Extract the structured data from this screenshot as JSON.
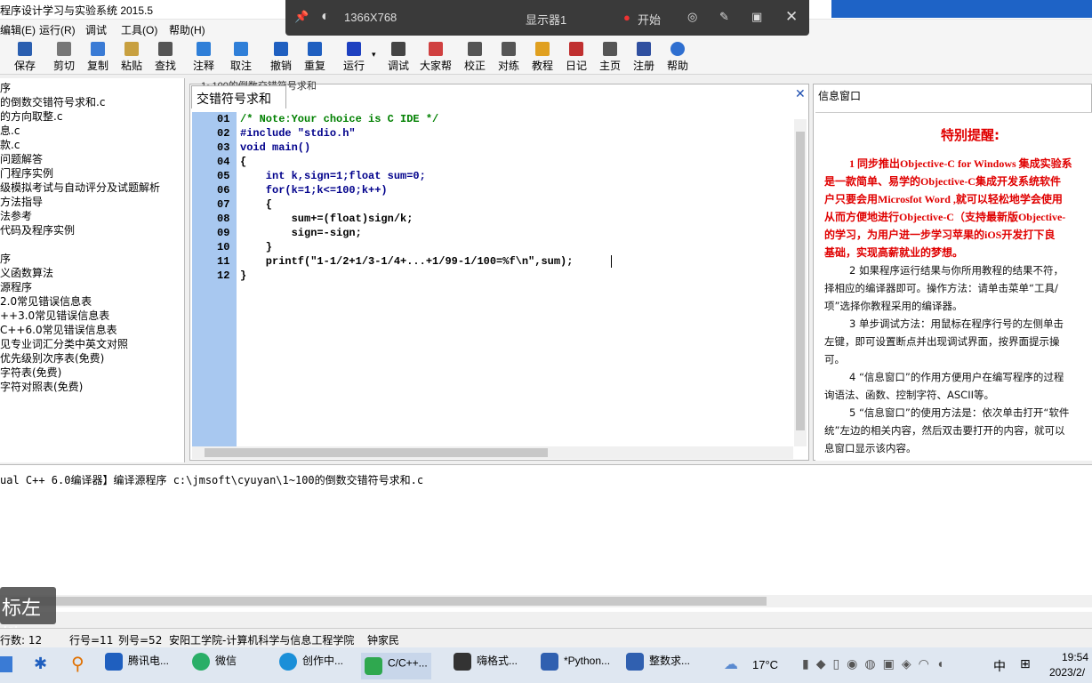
{
  "window": {
    "title": "程序设计学习与实验系统 2015.5"
  },
  "menu": [
    {
      "label": "编辑(E)"
    },
    {
      "label": "运行(R)"
    },
    {
      "label": "调试"
    },
    {
      "label": "工具(O)"
    },
    {
      "label": "帮助(H)"
    }
  ],
  "toolbar": [
    {
      "label": "保存",
      "icon": "save-icon",
      "color": "#2b5fb0"
    },
    {
      "label": "剪切",
      "icon": "cut-icon",
      "color": "#666666"
    },
    {
      "label": "复制",
      "icon": "copy-icon",
      "color": "#3a7bd5"
    },
    {
      "label": "粘贴",
      "icon": "paste-icon",
      "color": "#c8a040"
    },
    {
      "label": "查找",
      "icon": "find-icon",
      "color": "#555555"
    },
    {
      "label": "注释",
      "icon": "comment-icon",
      "color": "#2f7fd8"
    },
    {
      "label": "取注",
      "icon": "uncomment-icon",
      "color": "#2f7fd8"
    },
    {
      "label": "撤销",
      "icon": "undo-icon",
      "color": "#1f5fc0"
    },
    {
      "label": "重复",
      "icon": "redo-icon",
      "color": "#1f5fc0"
    },
    {
      "label": "运行",
      "icon": "run-icon",
      "color": "#1e40c0"
    },
    {
      "label": "调试",
      "icon": "debug-icon",
      "color": "#444444"
    },
    {
      "label": "大家帮",
      "icon": "help-people-icon",
      "color": "#d04040"
    },
    {
      "label": "校正",
      "icon": "check-icon",
      "color": "#444444"
    },
    {
      "label": "对练",
      "icon": "practice-icon",
      "color": "#444444"
    },
    {
      "label": "教程",
      "icon": "tutorial-icon",
      "color": "#e0a020"
    },
    {
      "label": "日记",
      "icon": "diary-icon",
      "color": "#c03030"
    },
    {
      "label": "主页",
      "icon": "home-icon",
      "color": "#444444"
    },
    {
      "label": "注册",
      "icon": "register-icon",
      "color": "#3050a0"
    },
    {
      "label": "帮助",
      "icon": "help-icon",
      "color": "#2f6fd0"
    }
  ],
  "recorder": {
    "resolution": "1366X768",
    "display": "显示器1",
    "start": "开始"
  },
  "left_tree": [
    "序",
    "的倒数交错符号求和.c",
    "的方向取整.c",
    "息.c",
    "款.c",
    "问题解答",
    "门程序实例",
    "级模拟考试与自动评分及试题解析",
    "方法指导",
    "法参考",
    "代码及程序实例",
    "",
    "序",
    "义函数算法",
    "源程序",
    "2.0常见错误信息表",
    "++3.0常见错误信息表",
    "C++6.0常见错误信息表",
    "见专业词汇分类中英文对照",
    "优先级别次序表(免费)",
    "字符表(免费)",
    "字符对照表(免费)"
  ],
  "editor": {
    "tab_title": "1~100的倒数交错符号求和",
    "tab_overlay": "交错符号求和",
    "lines": [
      {
        "no": "01",
        "code": "/* Note:Your choice is C IDE */"
      },
      {
        "no": "02",
        "code": "#include \"stdio.h\""
      },
      {
        "no": "03",
        "code": "void main()"
      },
      {
        "no": "04",
        "code": "{"
      },
      {
        "no": "05",
        "code": "    int k,sign=1;float sum=0;"
      },
      {
        "no": "06",
        "code": "    for(k=1;k<=100;k++)"
      },
      {
        "no": "07",
        "code": "    {"
      },
      {
        "no": "08",
        "code": "        sum+=(float)sign/k;"
      },
      {
        "no": "09",
        "code": "        sign=-sign;"
      },
      {
        "no": "10",
        "code": "    }"
      },
      {
        "no": "11",
        "code": "    printf(\"1-1/2+1/3-1/4+...+1/99-1/100=%f\\n\",sum);"
      },
      {
        "no": "12",
        "code": "}"
      }
    ]
  },
  "info": {
    "header": "信息窗口",
    "title": "特别提醒:",
    "red_lines": [
      "1 同步推出Objective-C for Windows 集成实验系",
      "是一款简单、易学的Objective-C集成开发系统软件",
      "户只要会用Microsfot Word ,就可以轻松地学会使用",
      "从而方便地进行Objective-C（支持最新版Objective-",
      "的学习，为用户进一步学习苹果的iOS开发打下良",
      "基础，实现高薪就业的梦想。"
    ],
    "black_lines": [
      "2 如果程序运行结果与你所用教程的结果不符，",
      "择相应的编译器即可。操作方法：请单击菜单“工具/",
      "项”选择你教程采用的编译器。",
      "3 单步调试方法：用鼠标在程序行号的左侧单击",
      "左键，即可设置断点并出现调试界面，按界面提示操",
      "可。",
      "4 “信息窗口”的作用方便用户在编写程序的过程",
      "询语法、函数、控制字符、ASCII等。",
      "5 “信息窗口”的使用方法是：依次单击打开“软件",
      "统”左边的相关内容，然后双击要打开的内容，就可以",
      "息窗口显示该内容。"
    ]
  },
  "output": {
    "text": "ual C++ 6.0编译器】编译源程序 c:\\jmsoft\\cyuyan\\1~100的倒数交错符号求和.c"
  },
  "key_hint": "标左键",
  "status": {
    "lines": "行数:  12",
    "row": "行号=11",
    "col": "列号=52",
    "org": "安阳工学院-计算机科学与信息工程学院",
    "author": "钟家民"
  },
  "taskbar": {
    "items": [
      {
        "label": "腾讯电...",
        "icon": "shield-icon",
        "color": "#1f5fbf"
      },
      {
        "label": "微信",
        "icon": "wechat-icon",
        "color": "#2aae67"
      },
      {
        "label": "创作中...",
        "icon": "edge-icon",
        "color": "#1a8fd8"
      },
      {
        "label": "C/C++...",
        "icon": "c-ide-icon",
        "color": "#2fa84f"
      },
      {
        "label": "嗨格式...",
        "icon": "video-icon",
        "color": "#333333"
      },
      {
        "label": "*Python...",
        "icon": "python-icon",
        "color": "#3060b0"
      },
      {
        "label": "整数求...",
        "icon": "doc-icon",
        "color": "#3060b0"
      }
    ],
    "weather": "17°C",
    "ime": "中",
    "time": "19:54",
    "date": "2023/2/"
  }
}
